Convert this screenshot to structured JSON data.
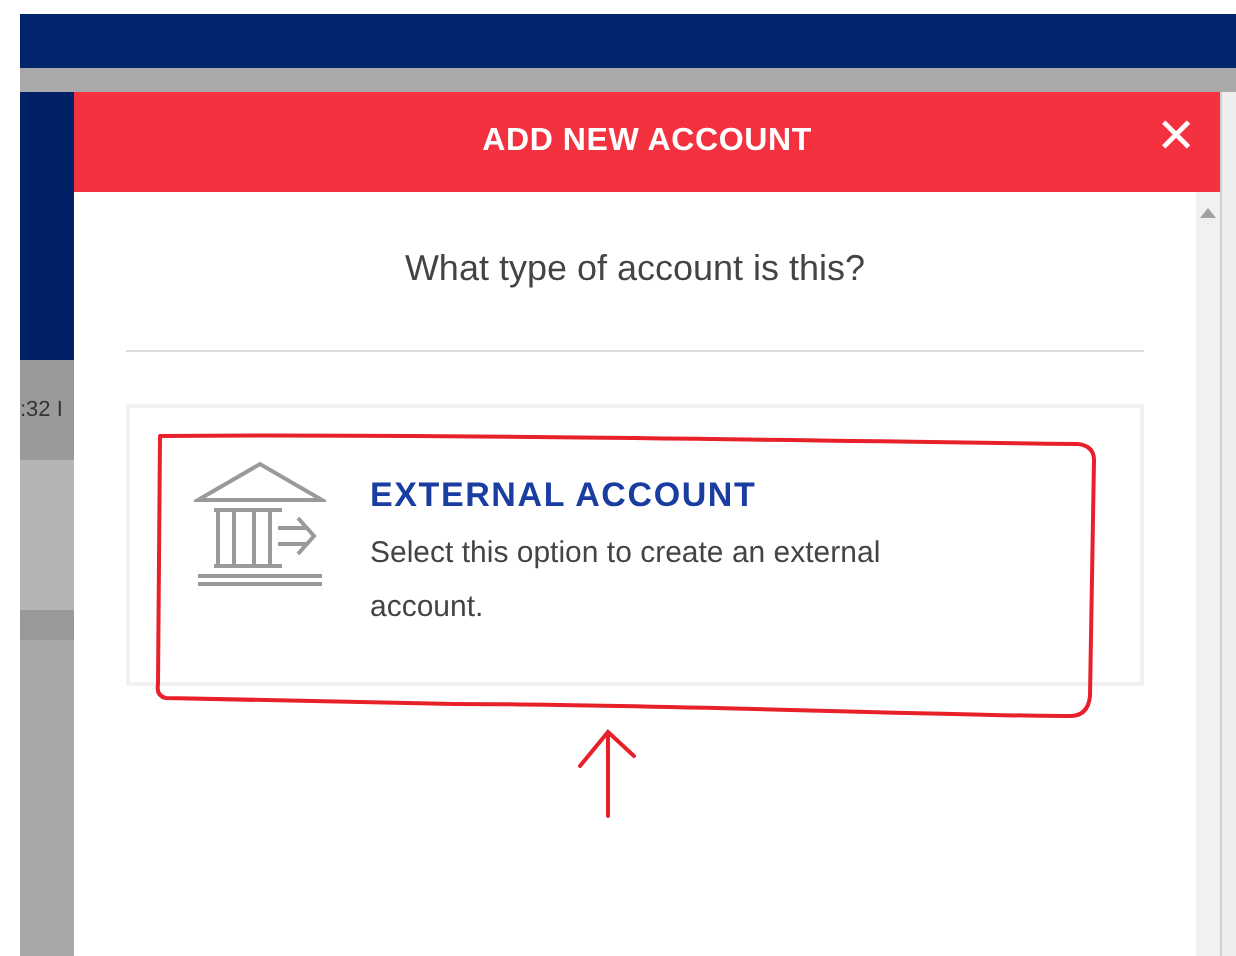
{
  "background": {
    "time_fragment": ":32 I"
  },
  "dialog": {
    "title": "ADD NEW ACCOUNT",
    "close_label": "✕",
    "question": "What type of account is this?",
    "options": [
      {
        "title": "EXTERNAL ACCOUNT",
        "description": "Select this option to create an external account.",
        "highlighted": true
      }
    ]
  }
}
